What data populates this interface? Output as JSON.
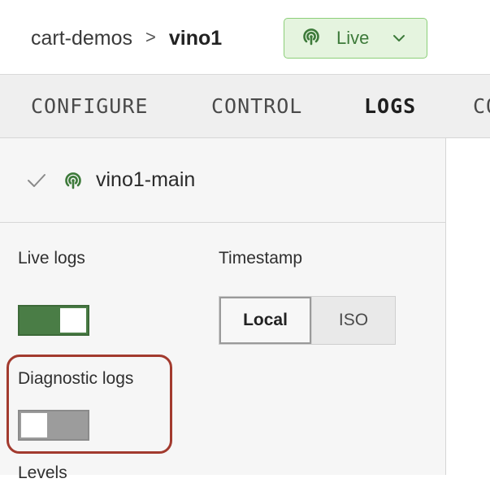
{
  "breadcrumb": {
    "project": "cart-demos",
    "separator": ">",
    "name": "vino1"
  },
  "status": {
    "label": "Live",
    "icon": "broadcast-icon",
    "color": "#3d7a3a"
  },
  "tabs": [
    {
      "label": "CONFIGURE",
      "active": false
    },
    {
      "label": "CONTROL",
      "active": false
    },
    {
      "label": "LOGS",
      "active": true
    },
    {
      "label": "CO",
      "active": false
    }
  ],
  "service": {
    "name": "vino1-main",
    "check_icon": "check-icon",
    "status_icon": "broadcast-icon"
  },
  "live_logs": {
    "label": "Live logs",
    "enabled": true
  },
  "timestamp": {
    "label": "Timestamp",
    "options": [
      "Local",
      "ISO"
    ],
    "selected": "Local"
  },
  "diagnostic_logs": {
    "label": "Diagnostic logs",
    "enabled": false
  },
  "levels": {
    "label": "Levels"
  },
  "colors": {
    "live_green": "#4a7d46",
    "highlight": "#a23a2e"
  }
}
